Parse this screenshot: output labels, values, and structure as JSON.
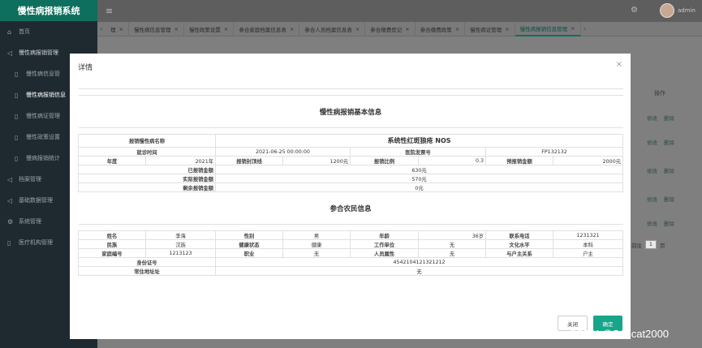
{
  "app": {
    "title": "慢性病报销系统"
  },
  "sidebar": {
    "items": [
      {
        "label": "首页",
        "icon": "home-icon",
        "glyph": "⌂"
      },
      {
        "label": "慢性病报销管理",
        "icon": "send-icon",
        "glyph": "◁"
      },
      {
        "label": "慢性病信息管",
        "icon": "doc-icon",
        "glyph": "▯"
      },
      {
        "label": "慢性病报销信息",
        "icon": "doc-icon",
        "glyph": "▯"
      },
      {
        "label": "慢性病证管理",
        "icon": "doc-icon",
        "glyph": "▯"
      },
      {
        "label": "慢性政策设置",
        "icon": "doc-icon",
        "glyph": "▯"
      },
      {
        "label": "慢病报销统计",
        "icon": "doc-icon",
        "glyph": "▯"
      },
      {
        "label": "档案管理",
        "icon": "send-icon",
        "glyph": "◁"
      },
      {
        "label": "基础数据管理",
        "icon": "send-icon",
        "glyph": "◁"
      },
      {
        "label": "系统管理",
        "icon": "gear-icon",
        "glyph": "⚙"
      },
      {
        "label": "医疗机构管理",
        "icon": "doc-icon",
        "glyph": "▯"
      }
    ]
  },
  "header": {
    "user": "admin",
    "menu_glyph": "≡",
    "gear_glyph": "⚙"
  },
  "tabs": {
    "prev_glyph": "‹",
    "next_glyph": "›",
    "close_glyph": "×",
    "items": [
      {
        "label": "理"
      },
      {
        "label": "慢性病信息管理"
      },
      {
        "label": "慢性政策设置"
      },
      {
        "label": "参合家庭档案信息表"
      },
      {
        "label": "参合人员档案信息表"
      },
      {
        "label": "参合缴费登记"
      },
      {
        "label": "参合缴费政策"
      },
      {
        "label": "慢性病证管理"
      },
      {
        "label": "慢性病报销信息管理"
      }
    ]
  },
  "background": {
    "op_header": "操作",
    "row_view": "修改",
    "row_delete": "删除",
    "pager_prefix": "前往",
    "pager_page": "1",
    "pager_suffix": "页"
  },
  "modal": {
    "title": "详情",
    "close_glyph": "×",
    "section1_title": "慢性病报销基本信息",
    "disease_label": "报销慢性病名称",
    "disease_value": "系统性红斑狼疮 NOS",
    "visit_time_label": "就诊时间",
    "visit_time_value": "2021-06-25 00:00:00",
    "invoice_label": "医院发票号",
    "invoice_value": "FP132132",
    "year_label": "年度",
    "year_value": "2021年",
    "threshold_label": "报销封顶线",
    "threshold_value": "1200元",
    "ratio_label": "报销比例",
    "ratio_value": "0.3",
    "pre_amount_label": "预报销金额",
    "pre_amount_value": "2000元",
    "reimbursed_label": "已报销金额",
    "reimbursed_value": "630元",
    "actual_label": "实际报销金额",
    "actual_value": "570元",
    "remaining_label": "剩余报销金额",
    "remaining_value": "0元",
    "section2_title": "参合农民信息",
    "name_label": "姓名",
    "name_value": "李海",
    "gender_label": "性别",
    "gender_value": "男",
    "age_label": "年龄",
    "age_value": "36岁",
    "phone_label": "联系电话",
    "phone_value": "1231321",
    "ethnic_label": "民族",
    "ethnic_value": "汉族",
    "health_label": "健康状态",
    "health_value": "健康",
    "work_label": "工作单位",
    "work_value": "无",
    "edu_label": "文化水平",
    "edu_value": "本科",
    "family_label": "家庭编号",
    "family_value": "1213123",
    "job_label": "职业",
    "job_value": "无",
    "attr_label": "人员属性",
    "attr_value": "无",
    "relation_label": "与户主关系",
    "relation_value": "户主",
    "id_label": "身份证号",
    "id_value": "4542104121321212",
    "address_label": "常住地址址",
    "address_value": "无",
    "btn_close": "关闭",
    "btn_ok": "确定"
  },
  "watermark": "CSDN @Soncat2000",
  "colors": {
    "accent": "#17a689",
    "logo_bg": "#0f6f5e",
    "sidebar_bg": "#1f2a30"
  }
}
